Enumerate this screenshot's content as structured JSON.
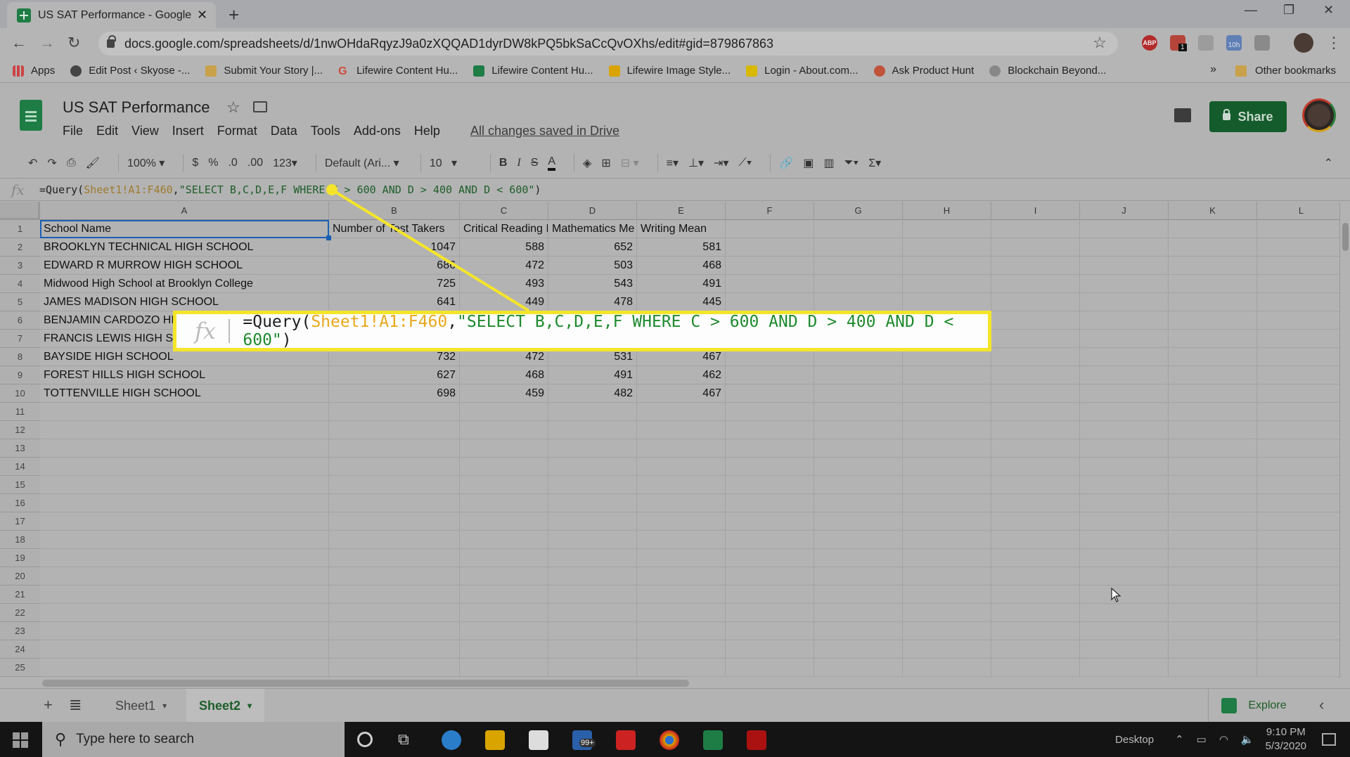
{
  "browser": {
    "tab_title": "US SAT Performance - Google Sh",
    "url": "docs.google.com/spreadsheets/d/1nwOHdaRqyzJ9a0zXQQAD1dyrDW8kPQ5bkSaCcQvOXhs/edit#gid=879867863",
    "extension_badge": "1",
    "extension_timer": "10h",
    "bookmarks": [
      {
        "label": "Apps",
        "color": "#3c6fd0"
      },
      {
        "label": "Edit Post ‹ Skyose -...",
        "color": "#444444"
      },
      {
        "label": "Submit Your Story |...",
        "color": "#c9a14a"
      },
      {
        "label": "Lifewire Content Hu...",
        "color": "#d04a3c"
      },
      {
        "label": "Lifewire Content Hu...",
        "color": "#1e7d45"
      },
      {
        "label": "Lifewire Image Style...",
        "color": "#d9a400"
      },
      {
        "label": "Login - About.com...",
        "color": "#d9b800"
      },
      {
        "label": "Ask Product Hunt",
        "color": "#c0533a"
      },
      {
        "label": "Blockchain Beyond...",
        "color": "#888888"
      }
    ],
    "bookmarks_more": "»",
    "other_bookmarks": "Other bookmarks"
  },
  "doc": {
    "title": "US SAT Performance",
    "menus": [
      "File",
      "Edit",
      "View",
      "Insert",
      "Format",
      "Data",
      "Tools",
      "Add-ons",
      "Help"
    ],
    "save_status": "All changes saved in Drive",
    "share_label": "Share"
  },
  "toolbar": {
    "zoom": "100%",
    "currency": "$",
    "percent": "%",
    "decrease_decimals": ".0",
    "increase_decimals": ".00",
    "more_formats": "123",
    "font": "Default (Ari...",
    "font_size": "10"
  },
  "formula": {
    "fx": "fx",
    "prefix": "=Query(",
    "ref": "Sheet1!A1:F460",
    "comma": ",",
    "query": "\"SELECT B,C,D,E,F WHERE C > 600 AND D > 400 AND D < 600\"",
    "suffix": ")"
  },
  "grid": {
    "columns": [
      "A",
      "B",
      "C",
      "D",
      "E",
      "F",
      "G",
      "H",
      "I",
      "J",
      "K",
      "L"
    ],
    "row_numbers": [
      "1",
      "2",
      "3",
      "4",
      "5",
      "6",
      "7",
      "8",
      "9",
      "10",
      "11",
      "12",
      "13",
      "14",
      "15",
      "16",
      "17",
      "18",
      "19",
      "20",
      "21",
      "22",
      "23",
      "24",
      "25"
    ],
    "header": [
      "School Name",
      "Number of Test Takers",
      "Critical Reading Mean",
      "Mathematics Mean",
      "Writing Mean"
    ],
    "header_display": [
      "School Name",
      "Number of Test Takers",
      "Critical Reading I",
      "Mathematics Me",
      "Writing Mean"
    ],
    "rows": [
      [
        "BROOKLYN TECHNICAL HIGH SCHOOL",
        "1047",
        "588",
        "652",
        "581"
      ],
      [
        "EDWARD R MURROW HIGH SCHOOL",
        "686",
        "472",
        "503",
        "468"
      ],
      [
        "Midwood High School at Brooklyn College",
        "725",
        "493",
        "543",
        "491"
      ],
      [
        "JAMES MADISON HIGH SCHOOL",
        "641",
        "449",
        "478",
        "445"
      ],
      [
        "BENJAMIN CARDOZO HIGH SCHOOL",
        "",
        "",
        "",
        ""
      ],
      [
        "FRANCIS LEWIS HIGH SCHOOL",
        "",
        "",
        "",
        ""
      ],
      [
        "BAYSIDE HIGH SCHOOL",
        "732",
        "472",
        "531",
        "467"
      ],
      [
        "FOREST HILLS HIGH SCHOOL",
        "627",
        "468",
        "491",
        "462"
      ],
      [
        "TOTTENVILLE HIGH SCHOOL",
        "698",
        "459",
        "482",
        "467"
      ]
    ],
    "selected_cell": "A1"
  },
  "callout": {
    "fx": "fx",
    "prefix": "=Query(",
    "ref": "Sheet1!A1:F460",
    "comma": ",",
    "query": "\"SELECT B,C,D,E,F WHERE C > 600 AND D > 400 AND D < 600\"",
    "suffix": ")",
    "color": "#f5e52a"
  },
  "sheets": {
    "tabs": [
      "Sheet1",
      "Sheet2"
    ],
    "active": "Sheet2",
    "explore_label": "Explore"
  },
  "taskbar": {
    "search_placeholder": "Type here to search",
    "mail_badge": "99+",
    "desktop_label": "Desktop",
    "time": "9:10 PM",
    "date": "5/3/2020"
  }
}
